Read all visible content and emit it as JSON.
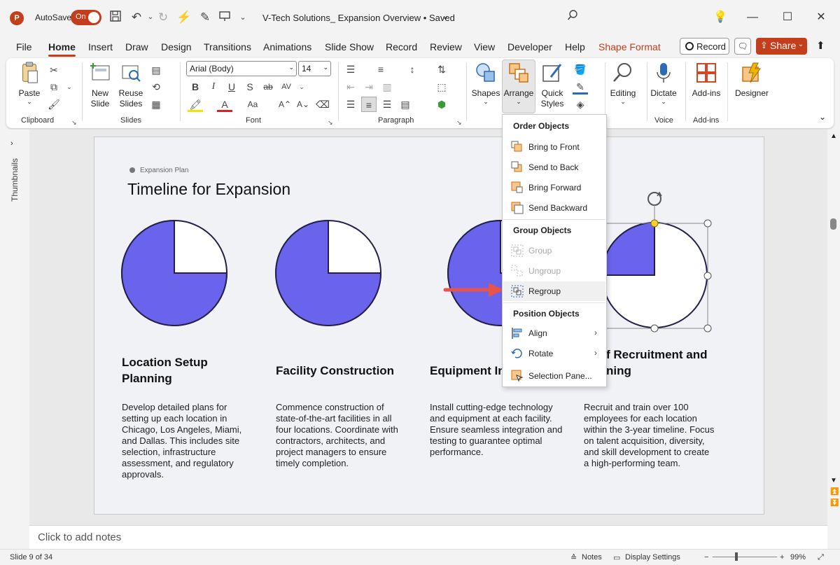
{
  "titlebar": {
    "autosave_label": "AutoSave",
    "toggle_state": "On",
    "doc_title": "V-Tech Solutions_ Expansion Overview • Saved"
  },
  "menu": {
    "tabs": [
      "File",
      "Home",
      "Insert",
      "Draw",
      "Design",
      "Transitions",
      "Animations",
      "Slide Show",
      "Record",
      "Review",
      "View",
      "Developer",
      "Help",
      "Shape Format"
    ],
    "active_tab": "Home",
    "record_label": "Record",
    "share_label": "Share"
  },
  "ribbon": {
    "clipboard": {
      "paste": "Paste",
      "group": "Clipboard"
    },
    "slides": {
      "new_slide": "New Slide",
      "reuse_slides": "Reuse Slides",
      "group": "Slides"
    },
    "font": {
      "font_name": "Arial (Body)",
      "font_size": "14",
      "group": "Font"
    },
    "paragraph": {
      "group": "Paragraph"
    },
    "drawing": {
      "shapes": "Shapes",
      "arrange": "Arrange",
      "quick_styles": "Quick Styles"
    },
    "editing": {
      "label": "Editing"
    },
    "voice": {
      "dictate": "Dictate",
      "group": "Voice"
    },
    "addins": {
      "label": "Add-ins",
      "group": "Add-ins"
    },
    "designer": {
      "label": "Designer"
    }
  },
  "thumbnails_label": "Thumbnails",
  "slide": {
    "kicker": "Expansion Plan",
    "title": "Timeline for Expansion",
    "pie_fill_color": "#6a64ec",
    "pie_border_color": "#241f4d",
    "columns": [
      {
        "heading_line1": "Location Setup",
        "heading_line2": "Planning",
        "body": [
          "Develop detailed plans for",
          "setting up each location in",
          "Chicago, Los Angeles, Miami,",
          "and Dallas. This includes site",
          "selection, infrastructure",
          "assessment, and regulatory",
          "approvals."
        ],
        "progress": 0.75
      },
      {
        "heading_line1": "Facility Construction",
        "heading_line2": "",
        "body": [
          "Commence construction of",
          "state-of-the-art facilities in all",
          "four locations. Coordinate with",
          "contractors, architects, and",
          "project managers to ensure",
          "timely completion."
        ],
        "progress": 0.75
      },
      {
        "heading_line1": "Equipment In",
        "heading_line2": "",
        "body": [
          "Install cutting-edge technology",
          "and equipment at each facility.",
          "Ensure seamless integration and",
          "testing to guarantee optimal",
          "performance."
        ],
        "progress": 0.75
      },
      {
        "heading_line1": "f Recruitment and",
        "heading_line2": "ning",
        "body": [
          "Recruit and train over 100",
          "employees for each location",
          "within the 3-year timeline. Focus",
          "on talent acquisition, diversity,",
          "and skill development to create",
          "a high-performing team."
        ],
        "progress": 0.25
      }
    ]
  },
  "arrange_menu": {
    "order_header": "Order Objects",
    "bring_to_front": "Bring to Front",
    "send_to_back": "Send to Back",
    "bring_forward": "Bring Forward",
    "send_backward": "Send Backward",
    "group_header": "Group Objects",
    "group": "Group",
    "ungroup": "Ungroup",
    "regroup": "Regroup",
    "position_header": "Position Objects",
    "align": "Align",
    "rotate": "Rotate",
    "selection_pane": "Selection Pane..."
  },
  "notes_placeholder": "Click to add notes",
  "status": {
    "slide_info": "Slide 9 of 34",
    "notes": "Notes",
    "display_settings": "Display Settings",
    "zoom": "99%"
  },
  "colors": {
    "accent": "#c43e1c",
    "arrow": "#e8534b"
  }
}
